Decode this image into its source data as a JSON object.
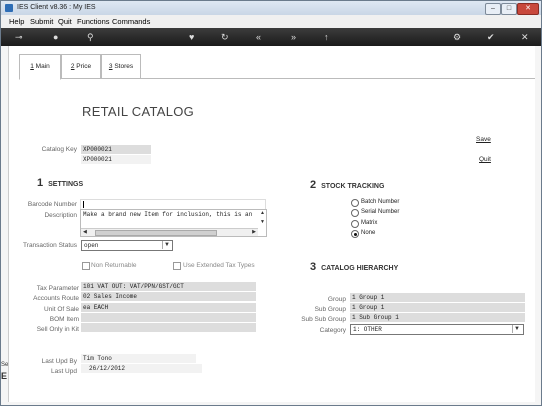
{
  "window": {
    "title": "IES Client v8.36 : My IES",
    "min": "–",
    "max": "□",
    "close": "✕"
  },
  "menu": [
    "Help",
    "Submit",
    "Quit",
    "Functions",
    "Commands"
  ],
  "toolbar": {
    "icons": [
      "back-key-icon",
      "help-icon",
      "search-icon",
      "favorite-icon",
      "refresh-icon",
      "rewind-icon",
      "fast-forward-icon",
      "upload-icon",
      "settings-icon",
      "check-icon",
      "close-icon"
    ]
  },
  "tabs": [
    {
      "key": "1",
      "label": " Main"
    },
    {
      "key": "2",
      "label": " Price"
    },
    {
      "key": "3",
      "label": " Stores"
    }
  ],
  "page_title": "RETAIL CATALOG",
  "actions": {
    "save": "Save",
    "quit": "Quit"
  },
  "catalog": {
    "key_label": "Catalog Key",
    "key_value": "XP000021",
    "key_value2": "XP000021"
  },
  "settings": {
    "num": "1",
    "title": "SETTINGS",
    "barcode_label": "Barcode Number",
    "barcode_value": "",
    "description_label": "Description",
    "description_value": "Make a brand new Item for inclusion, this is an",
    "transaction_status_label": "Transaction Status",
    "transaction_status_value": "open",
    "non_returnable_label": "Non Returnable",
    "use_extended_tax_label": "Use Extended Tax Types",
    "tax_parameter_label": "Tax Parameter",
    "tax_parameter_value": "101 VAT OUT: VAT/PPN/GST/GCT",
    "accounts_route_label": "Accounts Route",
    "accounts_route_value": "02 Sales Income",
    "unit_of_sale_label": "Unit Of Sale",
    "unit_of_sale_value": "ea EACH",
    "bom_item_label": "BOM Item",
    "bom_item_value": "",
    "sell_only_in_kit_label": "Sell Only in Kit",
    "sell_only_in_kit_value": "",
    "last_upd_by_label": "Last Upd By",
    "last_upd_by_value": "Tim Tono",
    "last_upd_label": "Last Upd",
    "last_upd_value": "26/12/2012"
  },
  "stock_tracking": {
    "num": "2",
    "title": "STOCK TRACKING",
    "options": [
      "Batch Number",
      "Serial Number",
      "Matrix",
      "None"
    ],
    "selected": "None"
  },
  "catalog_hierarchy": {
    "num": "3",
    "title": "CATALOG HIERARCHY",
    "group_label": "Group",
    "group_value": "1 Group 1",
    "sub_group_label": "Sub Group",
    "sub_group_value": "1 Group 1",
    "sub_sub_group_label": "Sub Sub Group",
    "sub_sub_group_value": "1 Sub Group 1",
    "category_label": "Category",
    "category_value": "1: OTHER"
  },
  "side_fragment": {
    "line1": "Sei",
    "line2": "E"
  }
}
